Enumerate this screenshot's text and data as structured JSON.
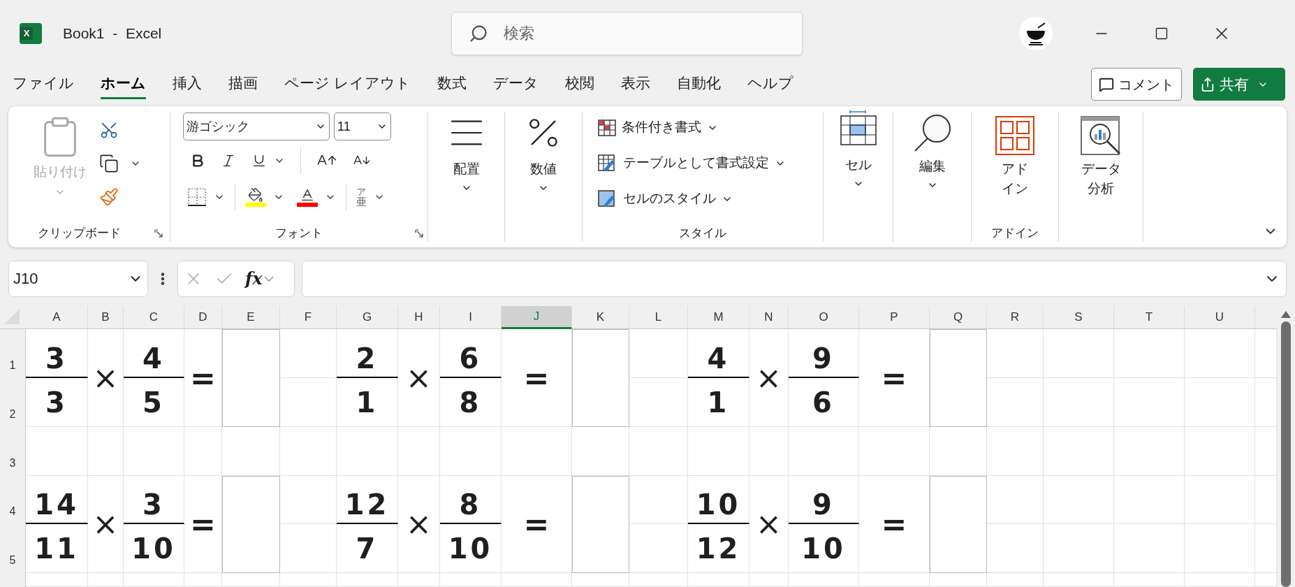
{
  "window": {
    "logo_letter": "X",
    "title": "Book1  -  Excel"
  },
  "search": {
    "placeholder": "検索"
  },
  "ribbon_tabs": [
    {
      "label": "ファイル",
      "selected": false
    },
    {
      "label": "ホーム",
      "selected": true
    },
    {
      "label": "挿入",
      "selected": false
    },
    {
      "label": "描画",
      "selected": false
    },
    {
      "label": "ページ レイアウト",
      "selected": false
    },
    {
      "label": "数式",
      "selected": false
    },
    {
      "label": "データ",
      "selected": false
    },
    {
      "label": "校閲",
      "selected": false
    },
    {
      "label": "表示",
      "selected": false
    },
    {
      "label": "自動化",
      "selected": false
    },
    {
      "label": "ヘルプ",
      "selected": false
    }
  ],
  "comment_button": {
    "label": "コメント"
  },
  "share_button": {
    "label": "共有"
  },
  "ribbon": {
    "clipboard": {
      "paste_label": "貼り付け",
      "paste_disabled": true,
      "group_label": "クリップボード"
    },
    "font": {
      "font_name": "游ゴシック",
      "font_size": "11",
      "phonetic_top": "ア",
      "phonetic_bottom": "亜",
      "group_label": "フォント"
    },
    "alignment": {
      "label": "配置"
    },
    "number": {
      "label": "数値"
    },
    "styles": {
      "items": [
        "条件付き書式",
        "テーブルとして書式設定",
        "セルのスタイル"
      ],
      "group_label": "スタイル"
    },
    "cells": {
      "label": "セル"
    },
    "editing": {
      "label": "編集"
    },
    "addins": {
      "label_lines": [
        "アド",
        "イン"
      ],
      "group_label": "アドイン"
    },
    "analysis": {
      "label_lines": [
        "データ",
        "分析"
      ]
    }
  },
  "formula_bar": {
    "name_box": "J10",
    "function_label": "fx"
  },
  "columns": [
    {
      "label": "A",
      "selected": false
    },
    {
      "label": "B",
      "selected": false
    },
    {
      "label": "C",
      "selected": false
    },
    {
      "label": "D",
      "selected": false
    },
    {
      "label": "E",
      "selected": false
    },
    {
      "label": "F",
      "selected": false
    },
    {
      "label": "G",
      "selected": false
    },
    {
      "label": "H",
      "selected": false
    },
    {
      "label": "I",
      "selected": false
    },
    {
      "label": "J",
      "selected": true
    },
    {
      "label": "K",
      "selected": false
    },
    {
      "label": "L",
      "selected": false
    },
    {
      "label": "M",
      "selected": false
    },
    {
      "label": "N",
      "selected": false
    },
    {
      "label": "O",
      "selected": false
    },
    {
      "label": "P",
      "selected": false
    },
    {
      "label": "Q",
      "selected": false
    },
    {
      "label": "R",
      "selected": false
    },
    {
      "label": "S",
      "selected": false
    },
    {
      "label": "T",
      "selected": false
    },
    {
      "label": "U",
      "selected": false
    }
  ],
  "row_headers": [
    "1",
    "2",
    "3",
    "4",
    "5"
  ],
  "problem_rows": [
    {
      "problems": [
        {
          "left": {
            "numerator": "3",
            "denominator": "3"
          },
          "operator": "×",
          "right": {
            "numerator": "4",
            "denominator": "5"
          },
          "equals": "="
        },
        {
          "left": {
            "numerator": "2",
            "denominator": "1"
          },
          "operator": "×",
          "right": {
            "numerator": "6",
            "denominator": "8"
          },
          "equals": "="
        },
        {
          "left": {
            "numerator": "4",
            "denominator": "1"
          },
          "operator": "×",
          "right": {
            "numerator": "9",
            "denominator": "6"
          },
          "equals": "="
        }
      ]
    },
    {
      "problems": [
        {
          "left": {
            "numerator": "14",
            "denominator": "11"
          },
          "operator": "×",
          "right": {
            "numerator": "3",
            "denominator": "10"
          },
          "equals": "="
        },
        {
          "left": {
            "numerator": "12",
            "denominator": "7"
          },
          "operator": "×",
          "right": {
            "numerator": "8",
            "denominator": "10"
          },
          "equals": "="
        },
        {
          "left": {
            "numerator": "10",
            "denominator": "12"
          },
          "operator": "×",
          "right": {
            "numerator": "9",
            "denominator": "10"
          },
          "equals": "="
        }
      ]
    }
  ]
}
